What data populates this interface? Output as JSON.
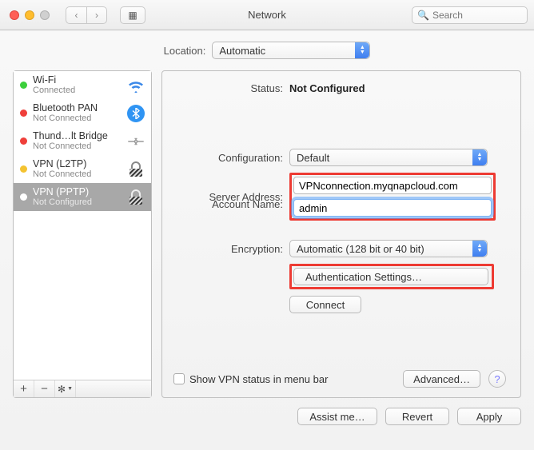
{
  "window": {
    "title": "Network"
  },
  "search": {
    "placeholder": "Search"
  },
  "location": {
    "label": "Location:",
    "value": "Automatic"
  },
  "sidebar": {
    "services": [
      {
        "name": "Wi-Fi",
        "status": "Connected",
        "dot": "green",
        "icon": "wifi"
      },
      {
        "name": "Bluetooth PAN",
        "status": "Not Connected",
        "dot": "red",
        "icon": "bluetooth"
      },
      {
        "name": "Thund…lt Bridge",
        "status": "Not Connected",
        "dot": "red",
        "icon": "thunderbolt"
      },
      {
        "name": "VPN (L2TP)",
        "status": "Not Connected",
        "dot": "yellow",
        "icon": "lock"
      },
      {
        "name": "VPN (PPTP)",
        "status": "Not Configured",
        "dot": "white",
        "icon": "lock",
        "selected": true
      }
    ]
  },
  "main": {
    "status_label": "Status:",
    "status_value": "Not Configured",
    "config_label": "Configuration:",
    "config_value": "Default",
    "server_label": "Server Address:",
    "server_value": "VPNconnection.myqnapcloud.com",
    "account_label": "Account Name:",
    "account_value": "admin",
    "enc_label": "Encryption:",
    "enc_value": "Automatic (128 bit or 40 bit)",
    "auth_button": "Authentication Settings…",
    "connect_button": "Connect",
    "show_vpn_label": "Show VPN status in menu bar",
    "advanced_button": "Advanced…"
  },
  "footer": {
    "assist": "Assist me…",
    "revert": "Revert",
    "apply": "Apply"
  }
}
